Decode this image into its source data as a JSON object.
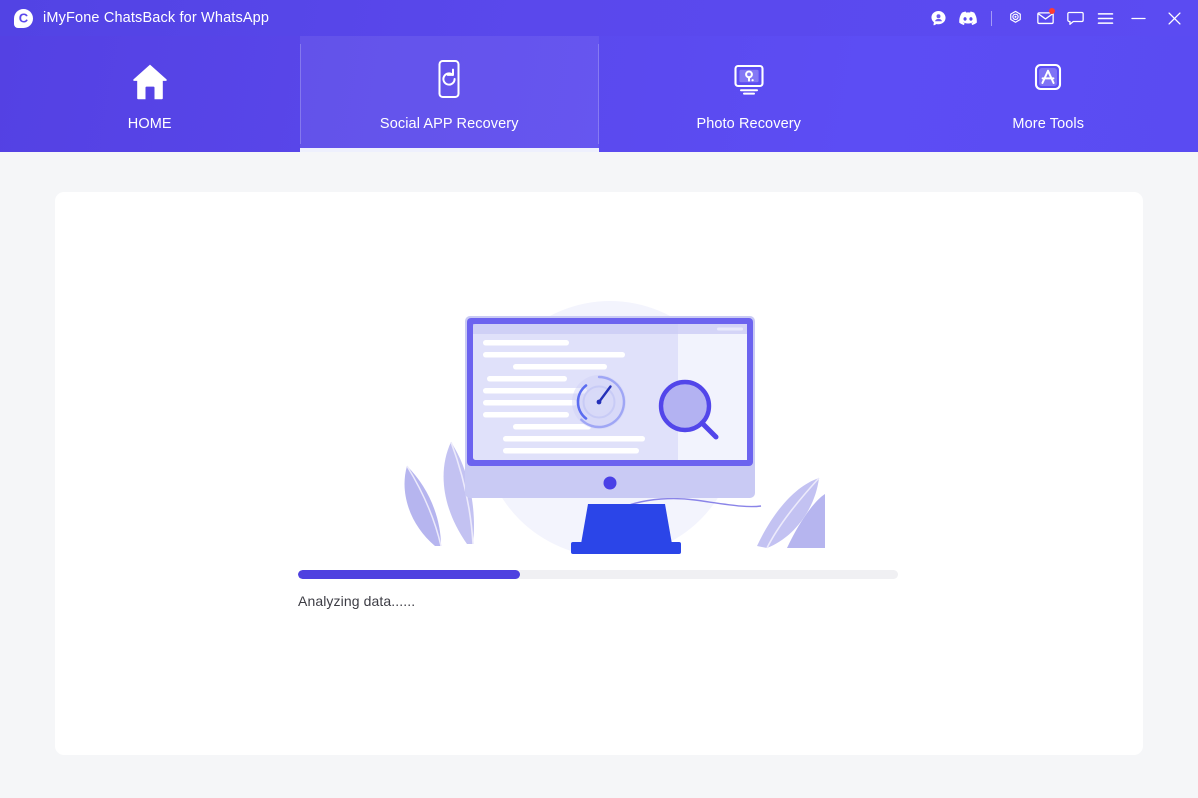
{
  "window": {
    "app_title": "iMyFone ChatsBack for WhatsApp",
    "logo_letter": "C",
    "logo_icon": "chatsback-logo-icon",
    "controls": [
      {
        "name": "account-icon",
        "tip": "Account"
      },
      {
        "name": "discord-icon",
        "tip": "Discord"
      },
      {
        "name": "separator",
        "tip": ""
      },
      {
        "name": "settings-icon",
        "tip": "Settings"
      },
      {
        "name": "mail-icon",
        "tip": "Messages",
        "badge": true
      },
      {
        "name": "feedback-icon",
        "tip": "Feedback"
      },
      {
        "name": "menu-icon",
        "tip": "Menu"
      },
      {
        "name": "minimize-icon",
        "tip": "Minimize"
      },
      {
        "name": "close-icon",
        "tip": "Close"
      }
    ]
  },
  "nav": {
    "tabs": [
      {
        "label": "HOME",
        "icon": "home-icon",
        "active": false
      },
      {
        "label": "Social APP Recovery",
        "icon": "refresh-phone-icon",
        "active": true
      },
      {
        "label": "Photo Recovery",
        "icon": "monitor-photo-icon",
        "active": false
      },
      {
        "label": "More Tools",
        "icon": "app-store-icon",
        "active": false
      }
    ]
  },
  "main": {
    "illustration": "analyzing-computer-illustration",
    "progress": {
      "percent": 37,
      "percent_css": "37%"
    },
    "status_text": "Analyzing data......"
  },
  "colors": {
    "header_gradient_start": "#5441e3",
    "header_gradient_end": "#5c4df4",
    "accent": "#4f41e0",
    "page_background": "#f5f6f8",
    "card_background": "#ffffff",
    "track": "#f0f0f3",
    "badge": "#ff3b30"
  }
}
